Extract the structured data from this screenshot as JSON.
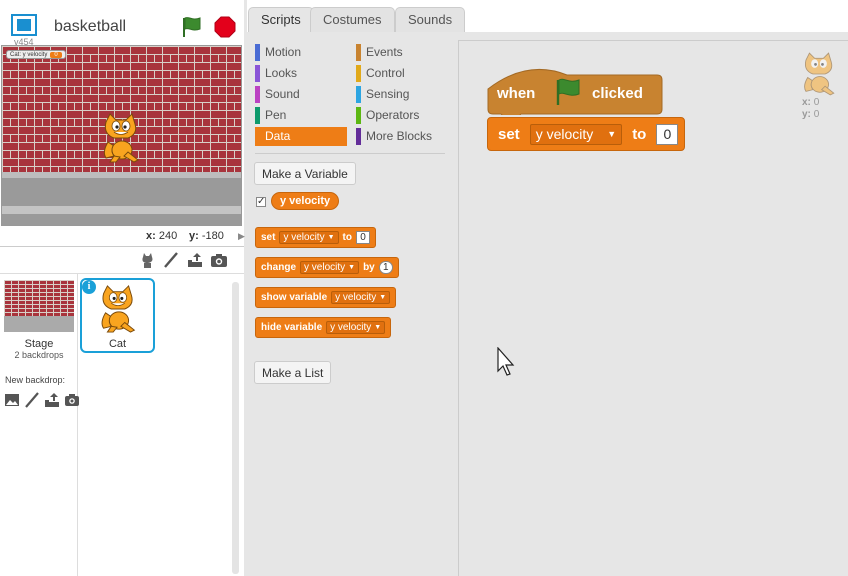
{
  "header": {
    "project_title": "basketball",
    "version": "v454"
  },
  "stage": {
    "monitor": {
      "label": "Cat: y velocity",
      "value": "0"
    },
    "coords": {
      "x_label": "x:",
      "x_value": "240",
      "y_label": "y:",
      "y_value": "-180"
    }
  },
  "sprites": {
    "stage_label": "Stage",
    "stage_sub": "2 backdrops",
    "new_backdrop_label": "New backdrop:",
    "selected_sprite": "Cat"
  },
  "tabs": [
    "Scripts",
    "Costumes",
    "Sounds"
  ],
  "categories": {
    "left": [
      {
        "label": "Motion",
        "color": "#4a6cd4"
      },
      {
        "label": "Looks",
        "color": "#8a55d7"
      },
      {
        "label": "Sound",
        "color": "#bb42c3"
      },
      {
        "label": "Pen",
        "color": "#0e9a6c"
      },
      {
        "label": "Data",
        "color": "#ee7d16"
      }
    ],
    "right": [
      {
        "label": "Events",
        "color": "#c88330"
      },
      {
        "label": "Control",
        "color": "#e1a91a"
      },
      {
        "label": "Sensing",
        "color": "#2ca5e2"
      },
      {
        "label": "Operators",
        "color": "#5cb712"
      },
      {
        "label": "More Blocks",
        "color": "#632d99"
      }
    ],
    "active": "Data"
  },
  "palette": {
    "make_variable": "Make a Variable",
    "variable_name": "y velocity",
    "variable_checked": "✓",
    "make_list": "Make a List",
    "blocks": {
      "set": {
        "word": "set",
        "var": "y velocity",
        "to": "to",
        "value": "0"
      },
      "change": {
        "word": "change",
        "var": "y velocity",
        "by": "by",
        "value": "1"
      },
      "show": {
        "word": "show variable",
        "var": "y velocity"
      },
      "hide": {
        "word": "hide variable",
        "var": "y velocity"
      }
    }
  },
  "script": {
    "hat": {
      "when": "when",
      "clicked": "clicked"
    },
    "set": {
      "word": "set",
      "var": "y velocity",
      "to": "to",
      "value": "0"
    },
    "corner": {
      "x_label": "x:",
      "x_value": "0",
      "y_label": "y:",
      "y_value": "0"
    }
  },
  "colors": {
    "data_orange": "#ee7d16",
    "selection_blue": "#1aa0d8",
    "flag_green": "#3c8a2e",
    "stop_red": "#e3001b"
  }
}
